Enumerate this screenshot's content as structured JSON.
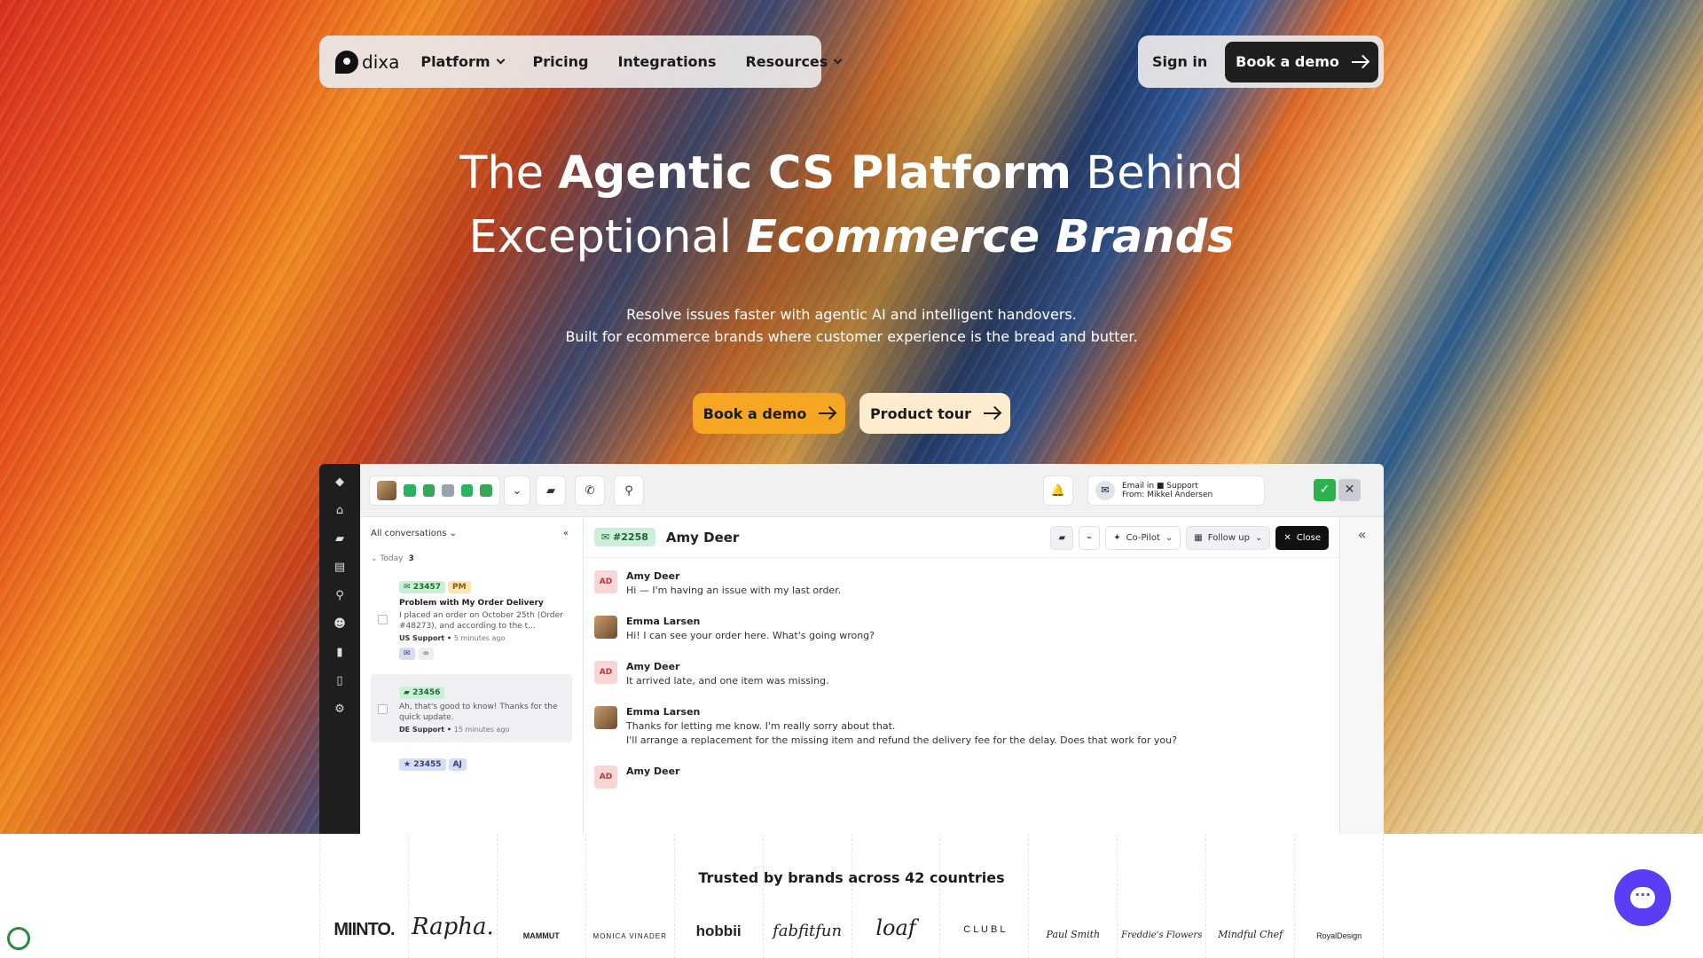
{
  "nav": {
    "logo_text": "dixa",
    "items": [
      {
        "label": "Platform",
        "dropdown": true
      },
      {
        "label": "Pricing",
        "dropdown": false
      },
      {
        "label": "Integrations",
        "dropdown": false
      },
      {
        "label": "Resources",
        "dropdown": true
      }
    ],
    "sign_in": "Sign in",
    "book_demo": "Book a demo"
  },
  "hero": {
    "line1_pre": "The ",
    "line1_bold": "Agentic CS Platform",
    "line1_post": " Behind",
    "line2_pre": "Exceptional ",
    "line2_em": "Ecommerce Brands",
    "sub1": "Resolve issues faster with agentic AI and intelligent handovers.",
    "sub2": "Built for ecommerce brands where customer experience is the bread and butter.",
    "cta_primary": "Book a demo",
    "cta_secondary": "Product tour"
  },
  "app": {
    "email_title": "Email in",
    "email_team": "Support",
    "email_from": "From: Mikkel Andersen",
    "list_filter": "All conversations",
    "group_label": "Today",
    "group_count": "3",
    "conversations": [
      {
        "id": "23457",
        "badge": "PM",
        "title": "Problem with My Order Delivery",
        "preview": "I placed an order on October 25th (Order #48273), and according to the t...",
        "team": "US Support",
        "time": "5 minutes ago"
      },
      {
        "id": "23456",
        "badge": "",
        "title": "",
        "preview": "Ah, that's good to know! Thanks for the quick update.",
        "team": "DE Support",
        "time": "15 minutes ago"
      },
      {
        "id": "23455",
        "badge": "AJ",
        "title": "",
        "preview": "",
        "team": "",
        "time": ""
      }
    ],
    "ticket": "#2258",
    "customer": "Amy Deer",
    "copilot": "Co-Pilot",
    "followup": "Follow up",
    "close": "Close",
    "messages": [
      {
        "initials": "AD",
        "name": "Amy Deer",
        "text": "Hi — I'm having an issue with my last order."
      },
      {
        "initials": "",
        "name": "Emma Larsen",
        "text": "Hi! I can see your order here. What's going wrong?"
      },
      {
        "initials": "AD",
        "name": "Amy Deer",
        "text": "It arrived late, and one item was missing."
      },
      {
        "initials": "",
        "name": "Emma Larsen",
        "text": "Thanks for letting me know. I'm really sorry about that."
      },
      {
        "initials": "AD",
        "name": "Amy Deer",
        "text": ""
      }
    ],
    "message4_line2": "I'll arrange a replacement for the missing item and refund the delivery fee for the delay. Does that work for you?"
  },
  "trusted": {
    "heading": "Trusted by brands across 42 countries",
    "brands": [
      "MIINTO.",
      "Rapha.",
      "MAMMUT",
      "MONICA VINADER",
      "hobbii",
      "fabfitfun",
      "loaf",
      "C L U B L",
      "Paul Smith",
      "Freddie's Flowers",
      "Mindful Chef",
      "RoyalDesign"
    ]
  },
  "colors": {
    "accent_orange": "#f5a623",
    "cream": "#fdeccd",
    "chat_purple": "#5b3df5"
  }
}
